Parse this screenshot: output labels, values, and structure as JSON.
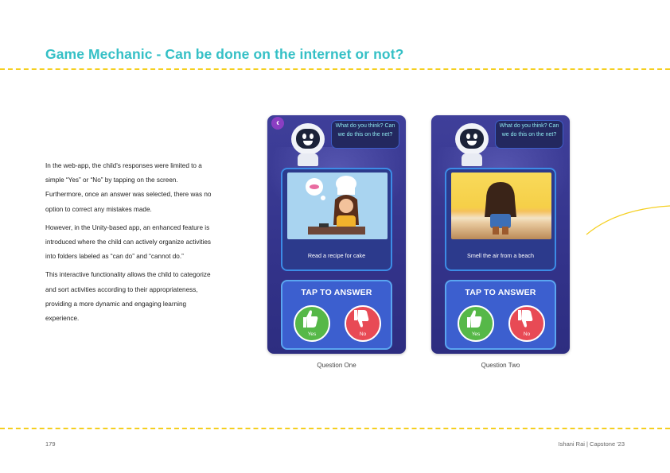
{
  "title": "Game Mechanic - Can be done on the internet or not?",
  "paragraphs": [
    "In the web-app, the child's responses were limited to a simple “Yes” or “No” by tapping on the screen. Furthermore, once an answer was selected, there was no option to correct any mistakes made.",
    "However, in the Unity-based app, an enhanced feature is introduced where the child can actively organize activities into folders labeled as “can do” and “cannot do.”",
    "This interactive functionality allows the child to categorize and sort activities according to their appropriateness, providing a more dynamic and engaging learning experience."
  ],
  "phones": [
    {
      "bubble": "What do you think? Can we do this on the net?",
      "question": "Read a recipe for cake",
      "tap_label": "TAP TO ANSWER",
      "yes_label": "Yes",
      "no_label": "No",
      "caption": "Question One"
    },
    {
      "bubble": "What do you think? Can we do this on the net?",
      "question": "Smell the air from a beach",
      "tap_label": "TAP TO ANSWER",
      "yes_label": "Yes",
      "no_label": "No",
      "caption": "Question Two"
    }
  ],
  "footer": {
    "page_number": "179",
    "author": "Ishani Rai | Capstone '23"
  },
  "colors": {
    "title": "#35c0c6",
    "dash": "#f5cf1f",
    "phone_bg": "#33338a",
    "yes": "#56b848",
    "no": "#e84a55"
  }
}
